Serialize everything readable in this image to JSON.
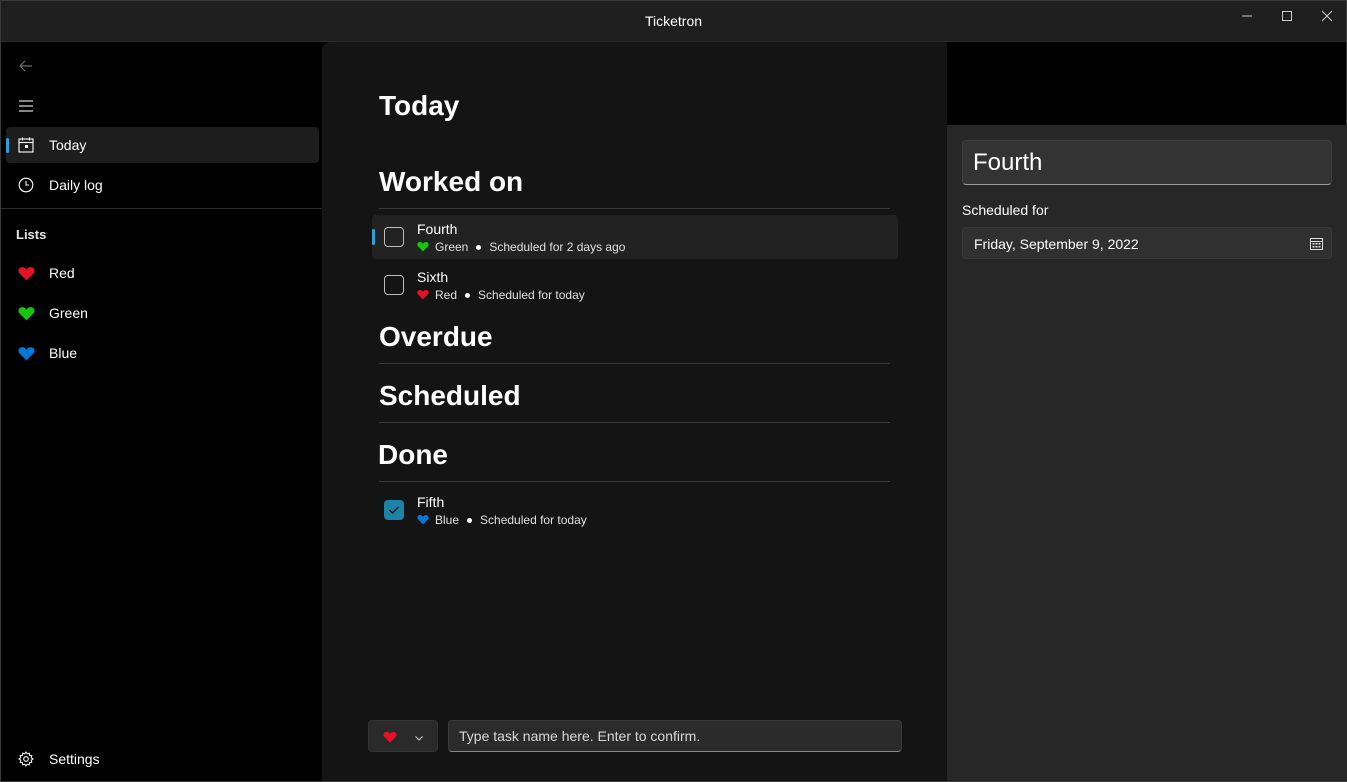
{
  "window": {
    "title": "Ticketron"
  },
  "sidebar": {
    "nav": [
      {
        "label": "Today",
        "icon": "calendar-today-icon",
        "selected": true
      },
      {
        "label": "Daily log",
        "icon": "clock-icon",
        "selected": false
      }
    ],
    "lists_header": "Lists",
    "lists": [
      {
        "label": "Red",
        "color": "#e81123"
      },
      {
        "label": "Green",
        "color": "#16c60c"
      },
      {
        "label": "Blue",
        "color": "#0078d7"
      }
    ],
    "settings_label": "Settings"
  },
  "main": {
    "page_title": "Today",
    "sections": {
      "worked_on": "Worked on",
      "overdue": "Overdue",
      "scheduled": "Scheduled",
      "done": "Done"
    },
    "tasks": [
      {
        "name": "Fourth",
        "list": "Green",
        "list_color": "#16c60c",
        "schedule": "Scheduled for 2 days ago",
        "done": false,
        "selected": true
      },
      {
        "name": "Sixth",
        "list": "Red",
        "list_color": "#e81123",
        "schedule": "Scheduled for today",
        "done": false,
        "selected": false
      },
      {
        "name": "Fifth",
        "list": "Blue",
        "list_color": "#0078d7",
        "schedule": "Scheduled for today",
        "done": true,
        "selected": false
      }
    ],
    "new_task": {
      "placeholder": "Type task name here. Enter to confirm.",
      "selected_list_color": "#e81123"
    }
  },
  "detail": {
    "title_value": "Fourth",
    "scheduled_label": "Scheduled for",
    "scheduled_date": "Friday, September 9, 2022"
  },
  "colors": {
    "accent": "#2f9fd6",
    "checkbox_checked": "#1c83a8"
  }
}
